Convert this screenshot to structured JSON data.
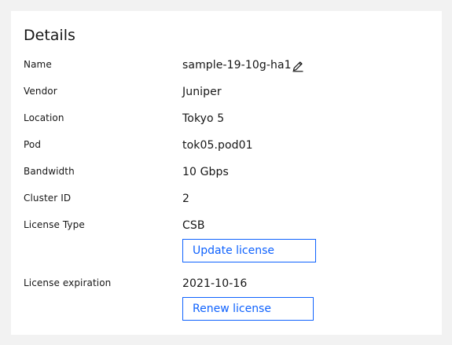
{
  "details": {
    "title": "Details",
    "rows": [
      {
        "label": "Name",
        "value": "sample-19-10g-ha1"
      },
      {
        "label": "Vendor",
        "value": "Juniper"
      },
      {
        "label": "Location",
        "value": "Tokyo 5"
      },
      {
        "label": "Pod",
        "value": "tok05.pod01"
      },
      {
        "label": "Bandwidth",
        "value": "10 Gbps"
      },
      {
        "label": "Cluster ID",
        "value": "2"
      },
      {
        "label": "License Type",
        "value": "CSB"
      },
      {
        "label": "License expiration",
        "value": "2021-10-16"
      }
    ],
    "update_license_label": "Update license",
    "renew_license_label": "Renew license",
    "edit_icon": "pencil-icon"
  }
}
